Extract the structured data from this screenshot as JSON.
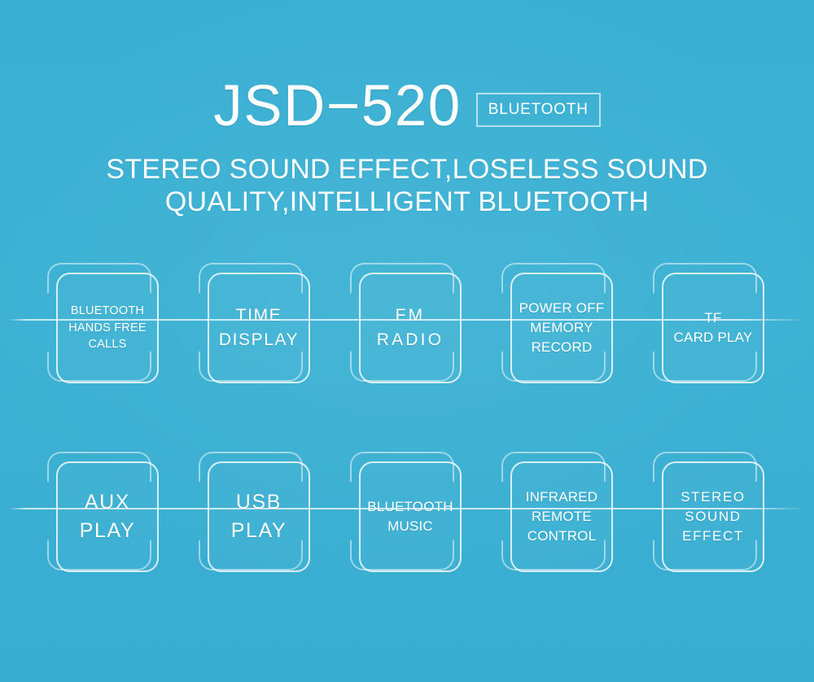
{
  "page": {
    "background_color": "#3bb0d2",
    "text_color": "#ffffff"
  },
  "header": {
    "product_title": "JSD−520",
    "badge_label": "BLUETOOTH",
    "subtitle_line_1": "STEREO SOUND EFFECT,LOSELESS SOUND",
    "subtitle_line_2": "QUALITY,INTELLIGENT BLUETOOTH"
  },
  "features": {
    "rows": [
      {
        "id": "row-1",
        "cells": [
          {
            "id": "bluetooth-hands-free-calls",
            "lines": [
              "BLUETOOTH",
              "HANDS FREE",
              " CALLS"
            ],
            "size": "sz-sm",
            "tracking": ""
          },
          {
            "id": "time-display",
            "lines": [
              "TIME",
              "DISPLAY"
            ],
            "size": "sz-lg",
            "tracking": "tr-mid"
          },
          {
            "id": "fm-radio",
            "lines": [
              "FM",
              "RADIO"
            ],
            "size": "sz-lg",
            "tracking": "tr-wide"
          },
          {
            "id": "power-off-memory-record",
            "lines": [
              "POWER OFF",
              "MEMORY",
              "RECORD"
            ],
            "size": "sz-md",
            "tracking": ""
          },
          {
            "id": "tf-card-play",
            "lines": [
              "TF",
              "CARD PLAY"
            ],
            "size": "sz-md",
            "tracking": ""
          }
        ]
      },
      {
        "id": "row-2",
        "cells": [
          {
            "id": "aux-play",
            "lines": [
              "AUX",
              "PLAY"
            ],
            "size": "sz-xl",
            "tracking": "tr-mid"
          },
          {
            "id": "usb-play",
            "lines": [
              "USB",
              "PLAY"
            ],
            "size": "sz-xl",
            "tracking": "tr-mid"
          },
          {
            "id": "bluetooth-music",
            "lines": [
              "BLUETOOTH",
              "MUSIC"
            ],
            "size": "sz-md",
            "tracking": ""
          },
          {
            "id": "infrared-remote-control",
            "lines": [
              "INFRARED",
              "REMOTE",
              "CONTROL"
            ],
            "size": "sz-md",
            "tracking": ""
          },
          {
            "id": "stereo-sound-effect",
            "lines": [
              "STEREO",
              "SOUND",
              "EFFECT"
            ],
            "size": "sz-md",
            "tracking": "tr-mid"
          }
        ]
      }
    ],
    "cell_x_positions": [
      55,
      241,
      427,
      613,
      799
    ]
  }
}
